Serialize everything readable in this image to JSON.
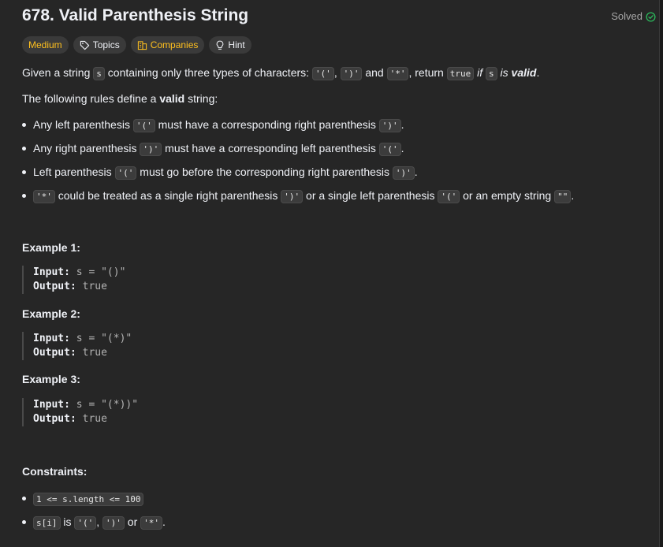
{
  "problem": {
    "title": "678. Valid Parenthesis String",
    "solved_label": "Solved"
  },
  "tags": {
    "difficulty": "Medium",
    "topics": "Topics",
    "companies": "Companies",
    "hint": "Hint"
  },
  "description": {
    "p1": {
      "t1": "Given a string ",
      "c1": "s",
      "t2": " containing only three types of characters: ",
      "c2": "'('",
      "t3": ", ",
      "c3": "')'",
      "t4": " and ",
      "c4": "'*'",
      "t5": ", return ",
      "c5": "true",
      "t6": " if ",
      "c6": "s",
      "t7": " is ",
      "t8": "valid",
      "t9": "."
    },
    "p2": {
      "t1": "The following rules define a ",
      "t2": "valid",
      "t3": " string:"
    },
    "rules": [
      {
        "t1": "Any left parenthesis ",
        "c1": "'('",
        "t2": " must have a corresponding right parenthesis ",
        "c2": "')'",
        "t3": "."
      },
      {
        "t1": "Any right parenthesis ",
        "c1": "')'",
        "t2": " must have a corresponding left parenthesis ",
        "c2": "'('",
        "t3": "."
      },
      {
        "t1": "Left parenthesis ",
        "c1": "'('",
        "t2": " must go before the corresponding right parenthesis ",
        "c2": "')'",
        "t3": "."
      },
      {
        "c1": "'*'",
        "t1": " could be treated as a single right parenthesis ",
        "c2": "')'",
        "t2": " or a single left parenthesis ",
        "c3": "'('",
        "t3": " or an empty string ",
        "c4": "\"\"",
        "t4": "."
      }
    ]
  },
  "examples": [
    {
      "title": "Example 1:",
      "input_label": "Input:",
      "input": "s = \"()\"",
      "output_label": "Output:",
      "output": "true"
    },
    {
      "title": "Example 2:",
      "input_label": "Input:",
      "input": "s = \"(*)\"",
      "output_label": "Output:",
      "output": "true"
    },
    {
      "title": "Example 3:",
      "input_label": "Input:",
      "input": "s = \"(*))\"",
      "output_label": "Output:",
      "output": "true"
    }
  ],
  "constraints": {
    "title": "Constraints:",
    "c1": "1 <= s.length <= 100",
    "c2": {
      "code1": "s[i]",
      "t1": " is ",
      "code2": "'('",
      "t2": ", ",
      "code3": "')'",
      "t3": " or ",
      "code4": "'*'",
      "t4": "."
    }
  },
  "colors": {
    "background": "#262626",
    "medium": "#ffc01e",
    "solved_check": "#2cbb5d"
  },
  "icons": [
    "check-circle-icon",
    "tag-icon",
    "building-icon",
    "lightbulb-icon"
  ]
}
